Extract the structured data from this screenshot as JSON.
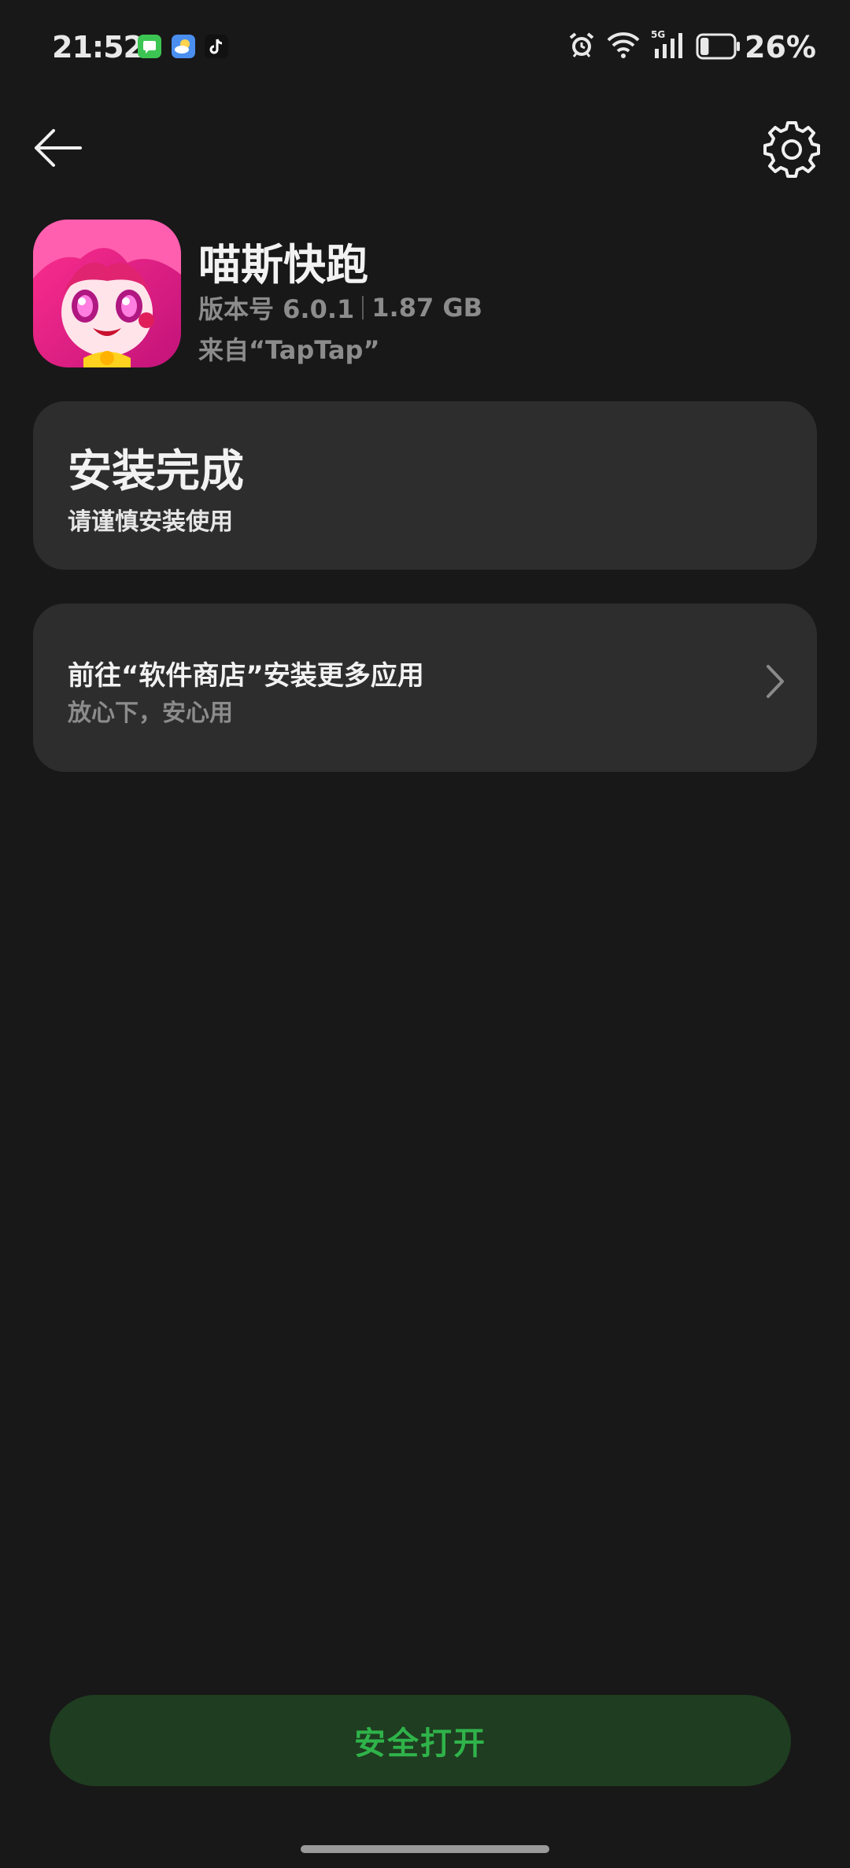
{
  "status_bar": {
    "time": "21:52",
    "notification_icons": [
      "messages-app-icon",
      "weather-app-icon",
      "tiktok-app-icon"
    ],
    "system_icons": [
      "alarm-icon",
      "wifi-icon",
      "signal-5g-icon",
      "battery-icon"
    ],
    "network_label": "5G",
    "battery_level": 0.26,
    "battery_text": "26%"
  },
  "nav": {
    "back_icon": "arrow-left-icon",
    "settings_icon": "gear-icon"
  },
  "app": {
    "name": "喵斯快跑",
    "version": "版本号 6.0.1",
    "size": "1.87 GB",
    "source": "来自“TapTap”"
  },
  "install_card": {
    "title": "安装完成",
    "subtitle": "请谨慎安装使用"
  },
  "store_card": {
    "title": "前往“软件商店”安装更多应用",
    "subtitle": "放心下，安心用",
    "chevron_icon": "chevron-right-icon"
  },
  "footer": {
    "open_button_label": "安全打开"
  },
  "colors": {
    "background": "#181818",
    "card": "#2d2d2d",
    "button_bg": "#1f3d20",
    "button_text": "#2fb34a",
    "secondary_text": "#8c8c8c"
  }
}
